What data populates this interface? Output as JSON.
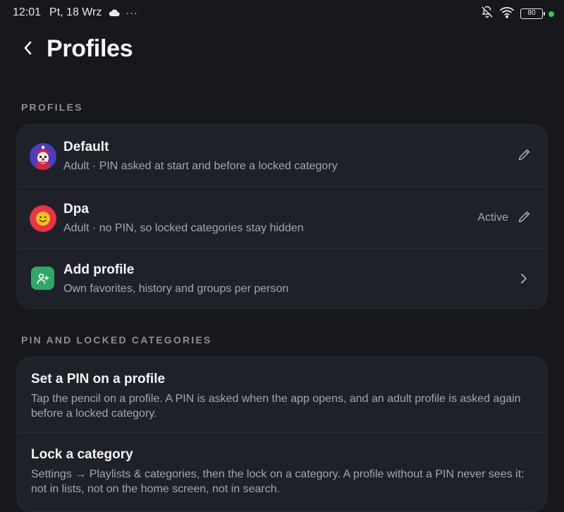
{
  "status_bar": {
    "time": "12:01",
    "date": "Pt, 18 Wrz",
    "more": "···",
    "battery": "80",
    "icons": [
      "cloud-icon",
      "bell-off-icon",
      "wifi-icon",
      "battery-icon"
    ]
  },
  "header": {
    "title": "Profiles",
    "back_icon": "chevron-left-icon"
  },
  "profiles_section": {
    "label": "PROFILES",
    "items": [
      {
        "name": "Default",
        "description": "Adult · PIN asked at start and before a locked category",
        "status": "",
        "avatar": "clown-avatar",
        "action_icon": "pencil-icon"
      },
      {
        "name": "Dpa",
        "description": "Adult · no PIN, so locked categories stay hidden",
        "status": "Active",
        "avatar": "smiley-avatar",
        "action_icon": "pencil-icon"
      }
    ],
    "add": {
      "title": "Add profile",
      "description": "Own favorites, history and groups per person",
      "icon": "add-person-icon",
      "action_icon": "chevron-right-icon"
    }
  },
  "pin_section": {
    "label": "PIN AND LOCKED CATEGORIES",
    "items": [
      {
        "title": "Set a PIN on a profile",
        "text": "Tap the pencil on a profile. A PIN is asked when the app opens, and an adult profile is asked again before a locked category."
      },
      {
        "title": "Lock a category",
        "text": "Settings → Playlists & categories, then the lock on a category. A profile without a PIN never sees it: not in lists, not on the home screen, not in search."
      }
    ]
  },
  "colors": {
    "background": "#17181c",
    "card": "#1f2128",
    "accent_green": "#2fa866",
    "avatar_red": "#e8334a",
    "status_dot": "#34c759"
  }
}
